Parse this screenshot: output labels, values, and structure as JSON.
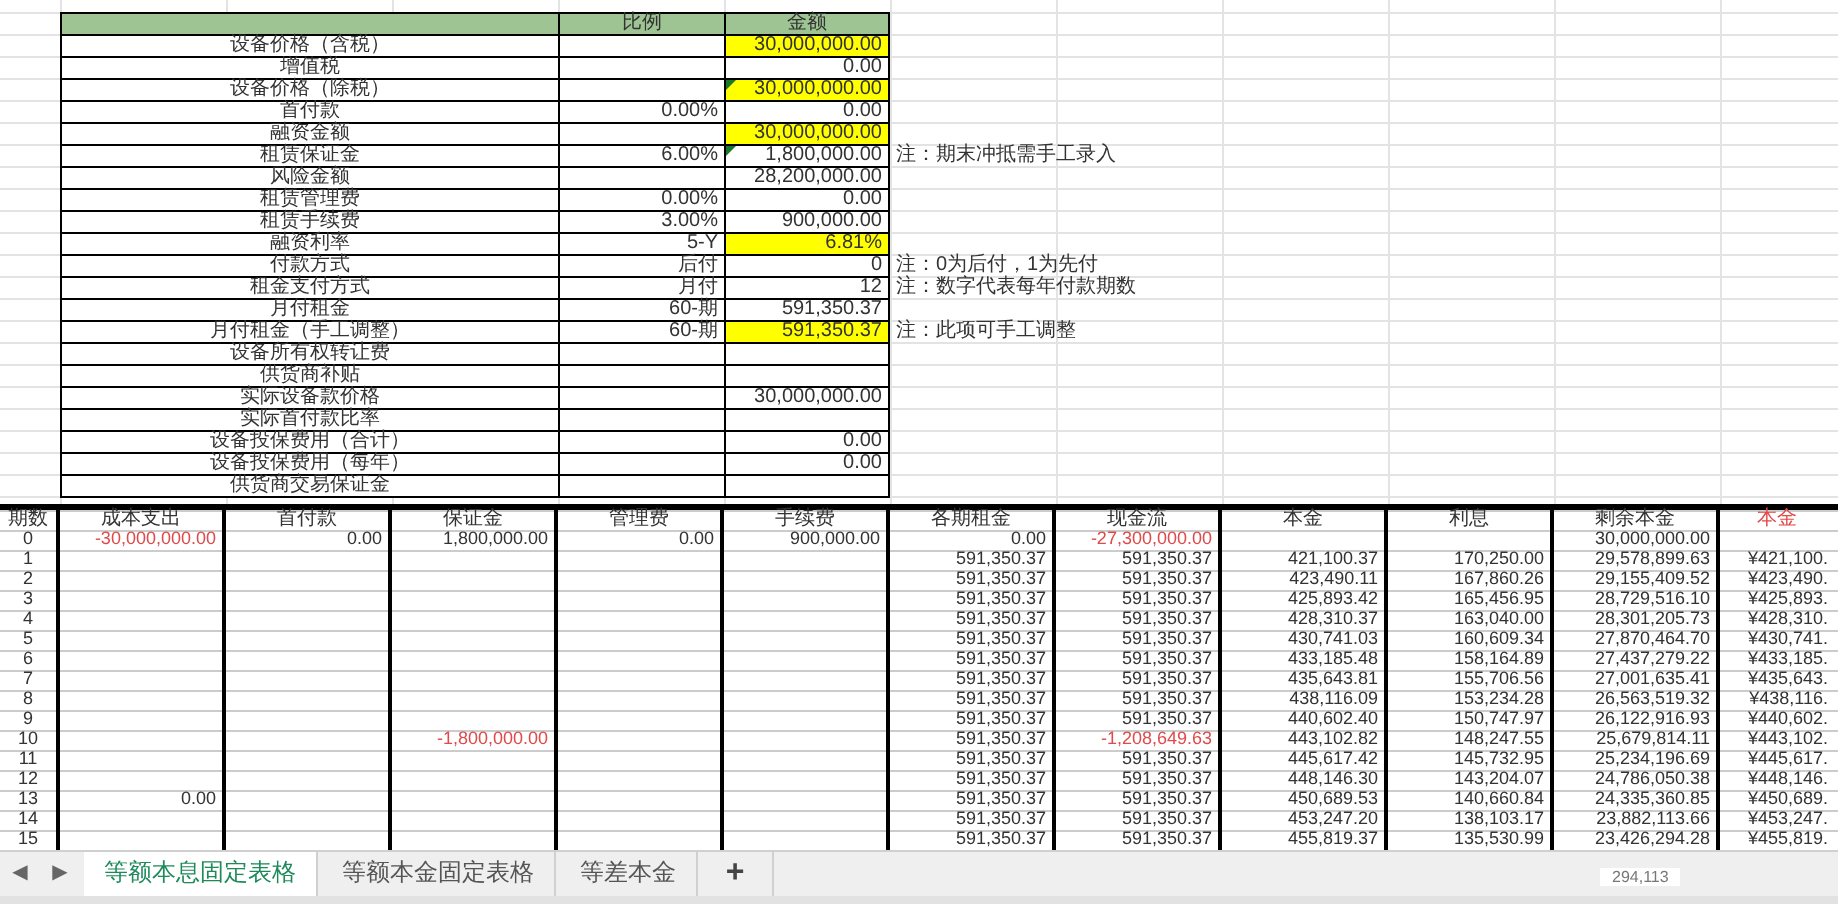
{
  "summary": {
    "columns": [
      "比例",
      "金额"
    ],
    "rows": [
      {
        "label": "设备价格（含税）",
        "amount": "30,000,000.00",
        "highlighted": true,
        "flagged": false
      },
      {
        "label": "增值税",
        "amount": "0.00",
        "highlighted": false,
        "flagged": false
      },
      {
        "label": "设备价格（除税）",
        "amount": "30,000,000.00",
        "highlighted": true,
        "flagged": true
      },
      {
        "label": "首付款",
        "ratio": "0.00%",
        "amount": "0.00",
        "highlighted": false,
        "flagged": false
      },
      {
        "label": "融资金额",
        "amount": "30,000,000.00",
        "highlighted": true,
        "flagged": false
      },
      {
        "label": "租赁保证金",
        "ratio": "6.00%",
        "amount": "1,800,000.00",
        "highlighted": false,
        "flagged": true,
        "note": "注：期末冲抵需手工录入"
      },
      {
        "label": "风险金额",
        "amount": "28,200,000.00",
        "highlighted": false,
        "flagged": false
      },
      {
        "label": "租赁管理费",
        "ratio": "0.00%",
        "amount": "0.00",
        "highlighted": false,
        "flagged": false
      },
      {
        "label": "租赁手续费",
        "ratio": "3.00%",
        "amount": "900,000.00",
        "highlighted": false,
        "flagged": false
      },
      {
        "label": "融资利率",
        "ratio": "5-Y",
        "amount": "6.81%",
        "highlighted": true,
        "flagged": false
      },
      {
        "label": "付款方式",
        "ratio": "后付",
        "amount": "0",
        "highlighted": false,
        "flagged": false,
        "note": "注：0为后付，1为先付"
      },
      {
        "label": "租金支付方式",
        "ratio": "月付",
        "amount": "12",
        "highlighted": false,
        "flagged": false,
        "note": "注：数字代表每年付款期数"
      },
      {
        "label": "月付租金",
        "ratio": "60-期",
        "amount": "591,350.37",
        "highlighted": false,
        "flagged": false
      },
      {
        "label": "月付租金（手工调整）",
        "ratio": "60-期",
        "amount": "591,350.37",
        "highlighted": true,
        "flagged": false,
        "note": "注：此项可手工调整"
      },
      {
        "label": "设备所有权转让费",
        "highlighted": false,
        "flagged": false
      },
      {
        "label": "供货商补贴",
        "highlighted": false,
        "flagged": false
      },
      {
        "label": "实际设备款价格",
        "amount": "30,000,000.00",
        "highlighted": false,
        "flagged": false
      },
      {
        "label": "实际首付款比率",
        "highlighted": false,
        "flagged": false
      },
      {
        "label": "设备投保费用（合计）",
        "amount": "0.00",
        "highlighted": false,
        "flagged": false
      },
      {
        "label": "设备投保费用（每年）",
        "amount": "0.00",
        "highlighted": false,
        "flagged": false
      },
      {
        "label": "供货商交易保证金",
        "highlighted": false,
        "flagged": false
      }
    ]
  },
  "schedule": {
    "columns": [
      {
        "label": "期数",
        "red": false
      },
      {
        "label": "成本支出",
        "red": false
      },
      {
        "label": "首付款",
        "red": false
      },
      {
        "label": "保证金",
        "red": false
      },
      {
        "label": "管理费",
        "red": false
      },
      {
        "label": "手续费",
        "red": false
      },
      {
        "label": "各期租金",
        "red": false
      },
      {
        "label": "现金流",
        "red": false
      },
      {
        "label": "本金",
        "red": false
      },
      {
        "label": "利息",
        "red": false
      },
      {
        "label": "剩余本金",
        "red": false
      },
      {
        "label": "本金",
        "red": true
      }
    ],
    "rows": [
      {
        "cells": [
          "0",
          {
            "text": "-30,000,000.00",
            "red": true
          },
          "0.00",
          "1,800,000.00",
          "0.00",
          "900,000.00",
          "0.00",
          {
            "text": "-27,300,000.00",
            "red": true
          },
          null,
          null,
          "30,000,000.00",
          null
        ]
      },
      {
        "cells": [
          "1",
          null,
          null,
          null,
          null,
          null,
          "591,350.37",
          "591,350.37",
          "421,100.37",
          "170,250.00",
          "29,578,899.63",
          "¥421,100."
        ]
      },
      {
        "cells": [
          "2",
          null,
          null,
          null,
          null,
          null,
          "591,350.37",
          "591,350.37",
          "423,490.11",
          "167,860.26",
          "29,155,409.52",
          "¥423,490."
        ]
      },
      {
        "cells": [
          "3",
          null,
          null,
          null,
          null,
          null,
          "591,350.37",
          "591,350.37",
          "425,893.42",
          "165,456.95",
          "28,729,516.10",
          "¥425,893."
        ]
      },
      {
        "cells": [
          "4",
          null,
          null,
          null,
          null,
          null,
          "591,350.37",
          "591,350.37",
          "428,310.37",
          "163,040.00",
          "28,301,205.73",
          "¥428,310."
        ]
      },
      {
        "cells": [
          "5",
          null,
          null,
          null,
          null,
          null,
          "591,350.37",
          "591,350.37",
          "430,741.03",
          "160,609.34",
          "27,870,464.70",
          "¥430,741."
        ]
      },
      {
        "cells": [
          "6",
          null,
          null,
          null,
          null,
          null,
          "591,350.37",
          "591,350.37",
          "433,185.48",
          "158,164.89",
          "27,437,279.22",
          "¥433,185."
        ]
      },
      {
        "cells": [
          "7",
          null,
          null,
          null,
          null,
          null,
          "591,350.37",
          "591,350.37",
          "435,643.81",
          "155,706.56",
          "27,001,635.41",
          "¥435,643."
        ]
      },
      {
        "cells": [
          "8",
          null,
          null,
          null,
          null,
          null,
          "591,350.37",
          "591,350.37",
          "438,116.09",
          "153,234.28",
          "26,563,519.32",
          "¥438,116."
        ]
      },
      {
        "cells": [
          "9",
          null,
          null,
          null,
          null,
          null,
          "591,350.37",
          "591,350.37",
          "440,602.40",
          "150,747.97",
          "26,122,916.93",
          "¥440,602."
        ]
      },
      {
        "cells": [
          "10",
          null,
          null,
          {
            "text": "-1,800,000.00",
            "red": true
          },
          null,
          null,
          "591,350.37",
          {
            "text": "-1,208,649.63",
            "red": true
          },
          "443,102.82",
          "148,247.55",
          "25,679,814.11",
          "¥443,102."
        ]
      },
      {
        "cells": [
          "11",
          null,
          null,
          null,
          null,
          null,
          "591,350.37",
          "591,350.37",
          "445,617.42",
          "145,732.95",
          "25,234,196.69",
          "¥445,617."
        ]
      },
      {
        "cells": [
          "12",
          null,
          null,
          null,
          null,
          null,
          "591,350.37",
          "591,350.37",
          "448,146.30",
          "143,204.07",
          "24,786,050.38",
          "¥448,146."
        ]
      },
      {
        "cells": [
          "13",
          "0.00",
          null,
          null,
          null,
          null,
          "591,350.37",
          "591,350.37",
          "450,689.53",
          "140,660.84",
          "24,335,360.85",
          "¥450,689."
        ]
      },
      {
        "cells": [
          "14",
          null,
          null,
          null,
          null,
          null,
          "591,350.37",
          "591,350.37",
          "453,247.20",
          "138,103.17",
          "23,882,113.66",
          "¥453,247."
        ]
      },
      {
        "cells": [
          "15",
          null,
          null,
          null,
          null,
          null,
          "591,350.37",
          "591,350.37",
          "455,819.37",
          "135,530.99",
          "23,426,294.28",
          "¥455,819."
        ]
      }
    ]
  },
  "sheet_nav": [
    "◀",
    "▶"
  ],
  "sheet_tabs": [
    {
      "label": "等额本息固定表格",
      "selected": true
    },
    {
      "label": "等额本金固定表格",
      "selected": false
    },
    {
      "label": "等差本金",
      "selected": false
    }
  ],
  "add_sheet": "+",
  "stray_text": "294,113"
}
